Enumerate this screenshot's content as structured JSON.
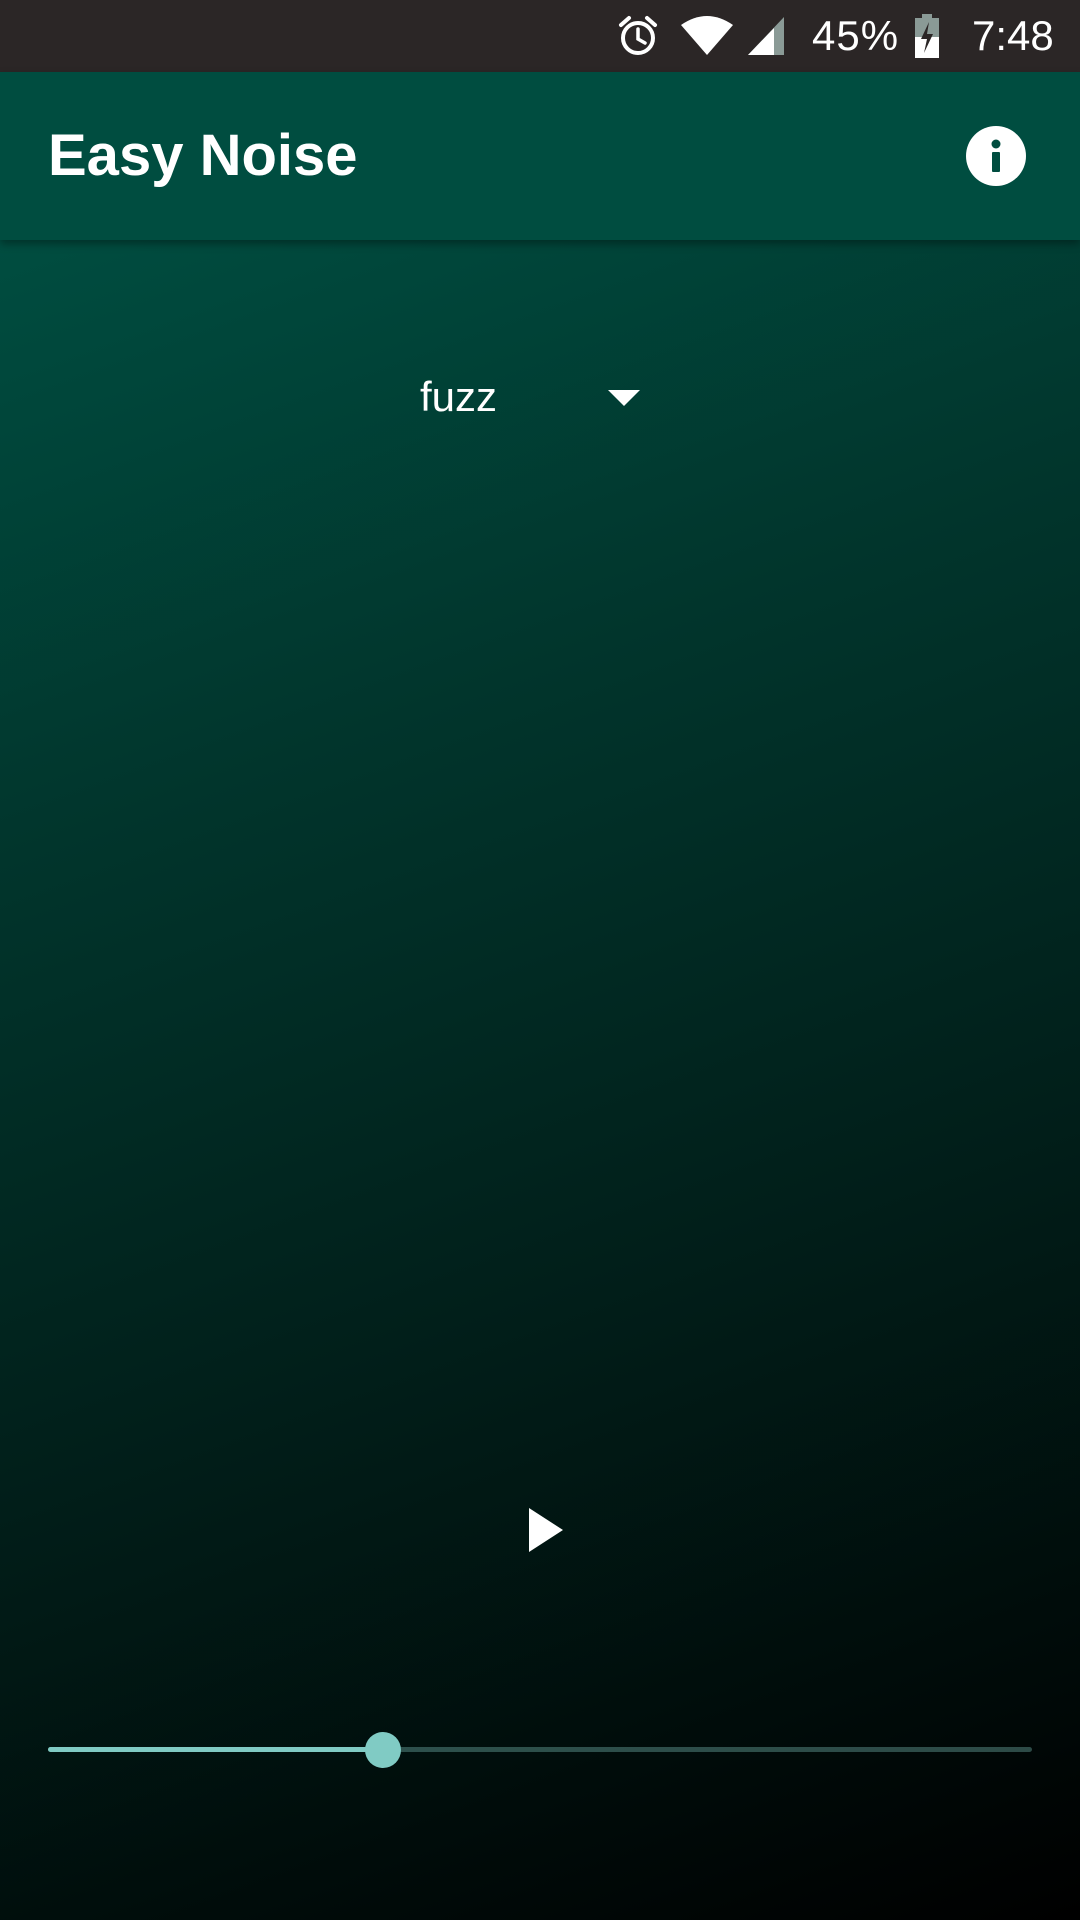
{
  "status_bar": {
    "alarm_icon": "alarm-clock-icon",
    "wifi_icon": "wifi-icon",
    "signal_icon": "cell-signal-icon",
    "battery_percent": "45%",
    "battery_icon": "battery-charging-icon",
    "time": "7:48"
  },
  "app_bar": {
    "title": "Easy Noise",
    "info_icon": "info-icon",
    "background": "#004d40"
  },
  "main": {
    "noise_type": {
      "selected": "fuzz",
      "arrow_icon": "dropdown-arrow-icon"
    },
    "play_icon": "play-icon",
    "volume": {
      "value": 0.34,
      "accent": "#80cbc4"
    }
  }
}
